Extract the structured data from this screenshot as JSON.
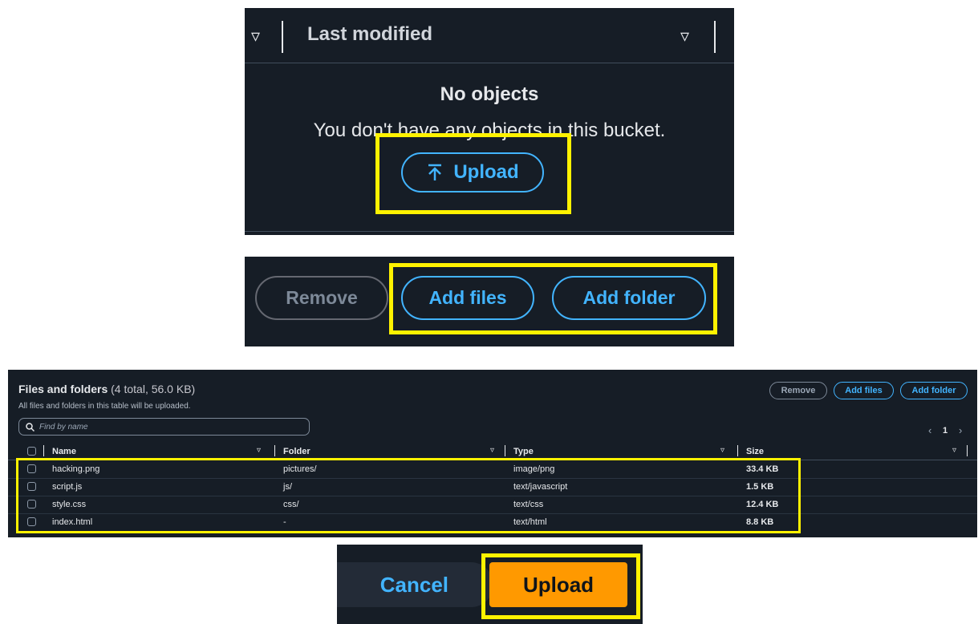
{
  "panel1": {
    "header_label": "Last modified",
    "empty_title": "No objects",
    "empty_description": "You don't have any objects in this bucket.",
    "upload_label": "Upload"
  },
  "panel2": {
    "remove_label": "Remove",
    "add_files_label": "Add files",
    "add_folder_label": "Add folder"
  },
  "panel3": {
    "title": "Files and folders",
    "count": "(4 total, 56.0 KB)",
    "subtitle": "All files and folders in this table will be uploaded.",
    "search_placeholder": "Find by name",
    "remove_label": "Remove",
    "add_files_label": "Add files",
    "add_folder_label": "Add folder",
    "page_number": "1",
    "columns": [
      "Name",
      "Folder",
      "Type",
      "Size"
    ],
    "rows": [
      {
        "name": "hacking.png",
        "folder": "pictures/",
        "type": "image/png",
        "size": "33.4 KB"
      },
      {
        "name": "script.js",
        "folder": "js/",
        "type": "text/javascript",
        "size": "1.5 KB"
      },
      {
        "name": "style.css",
        "folder": "css/",
        "type": "text/css",
        "size": "12.4 KB"
      },
      {
        "name": "index.html",
        "folder": "-",
        "type": "text/html",
        "size": "8.8 KB"
      }
    ]
  },
  "panel4": {
    "cancel_label": "Cancel",
    "upload_label": "Upload"
  },
  "colors": {
    "background": "#161d26",
    "accent_blue": "#42b4ff",
    "primary_orange": "#ff9900",
    "highlight_yellow": "#fff200"
  }
}
